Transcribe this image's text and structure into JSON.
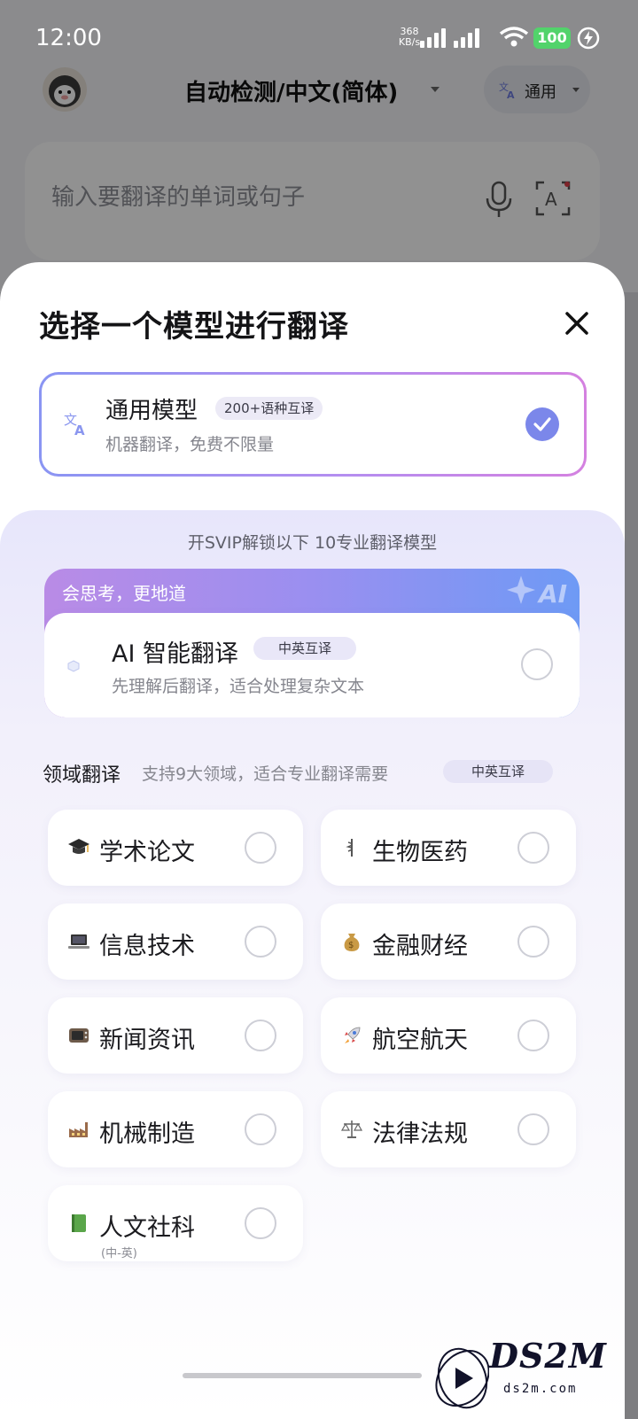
{
  "status_bar": {
    "time": "12:00",
    "net_speed_value": "368",
    "net_speed_unit": "KB/s",
    "battery": "100"
  },
  "header": {
    "language": "自动检测/中文(简体)",
    "mode": "通用"
  },
  "search": {
    "placeholder": "输入要翻译的单词或句子"
  },
  "sheet": {
    "title": "选择一个模型进行翻译",
    "general": {
      "name": "通用模型",
      "tag": "200+语种互译",
      "desc": "机器翻译，免费不限量",
      "selected": true
    },
    "svip_note": "开SVIP解锁以下 10专业翻译模型",
    "ai": {
      "banner": "会思考，更地道",
      "deco": "AI",
      "name": "AI 智能翻译",
      "tag": "中英互译",
      "desc": "先理解后翻译，适合处理复杂文本"
    },
    "domain": {
      "heading": "领域翻译",
      "subheading": "支持9大领域，适合专业翻译需要",
      "tag": "中英互译",
      "items": [
        {
          "label": "学术论文",
          "icon": "graduation-cap-icon"
        },
        {
          "label": "生物医药",
          "icon": "medical-icon"
        },
        {
          "label": "信息技术",
          "icon": "laptop-icon"
        },
        {
          "label": "金融财经",
          "icon": "money-bag-icon"
        },
        {
          "label": "新闻资讯",
          "icon": "television-icon"
        },
        {
          "label": "航空航天",
          "icon": "rocket-icon"
        },
        {
          "label": "机械制造",
          "icon": "factory-icon"
        },
        {
          "label": "法律法规",
          "icon": "scales-icon"
        },
        {
          "label": "人文社科",
          "sub": "(中-英)",
          "icon": "green-book-icon"
        }
      ]
    }
  },
  "watermark": {
    "brand": "DS2M",
    "site": "ds2m.com"
  },
  "colors": {
    "accent": "#7b87ea",
    "gradient_start": "#b98be6",
    "gradient_end": "#6e9af5",
    "battery": "#52d36b"
  }
}
